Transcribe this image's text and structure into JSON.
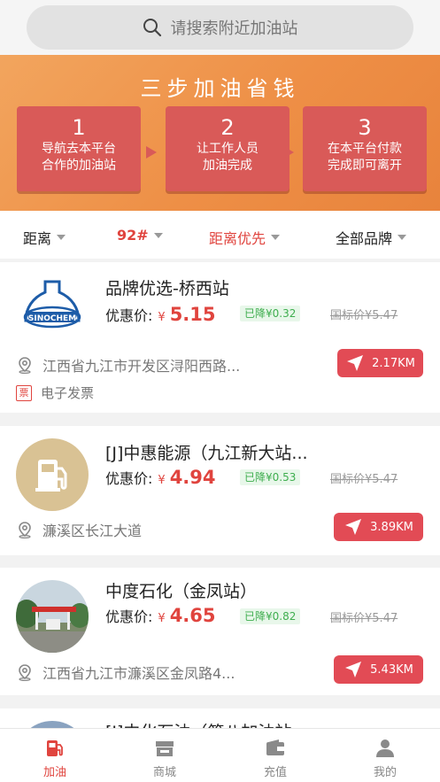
{
  "search": {
    "placeholder": "请搜索附近加油站"
  },
  "banner": {
    "title": "三步加油省钱",
    "steps": [
      {
        "num": "1",
        "line1": "导航去本平台",
        "line2": "合作的加油站"
      },
      {
        "num": "2",
        "line1": "让工作人员",
        "line2": "加油完成"
      },
      {
        "num": "3",
        "line1": "在本平台付款",
        "line2": "完成即可离开"
      }
    ]
  },
  "filters": [
    {
      "label": "距离",
      "active": false
    },
    {
      "label": "92#",
      "active": true
    },
    {
      "label": "距离优先",
      "active": true
    },
    {
      "label": "全部品牌",
      "active": false
    }
  ],
  "stations": [
    {
      "name": "品牌优选-桥西站",
      "price_label": "优惠价:",
      "yen": "¥",
      "price": "5.15",
      "drop": "已降¥0.32",
      "std_price": "国标价¥5.47",
      "address": "江西省九江市开发区浔阳西路...",
      "distance": "2.17KM",
      "invoice": "电子发票",
      "invoice_icon": "票",
      "logo": "sinochem-logo"
    },
    {
      "name": "[J]中惠能源（九江新大站...",
      "price_label": "优惠价:",
      "yen": "¥",
      "price": "4.94",
      "drop": "已降¥0.53",
      "std_price": "国标价¥5.47",
      "address": "濂溪区长江大道",
      "distance": "3.89KM",
      "logo": "fuel-pump-icon"
    },
    {
      "name": "中度石化（金凤站）",
      "price_label": "优惠价:",
      "yen": "¥",
      "price": "4.65",
      "drop": "已降¥0.82",
      "std_price": "国标价¥5.47",
      "address": "江西省九江市濂溪区金凤路4...",
      "distance": "5.43KM",
      "logo": "station-photo"
    },
    {
      "name": "[J]中化石油（第八加油站",
      "logo": "station-photo"
    }
  ],
  "tabbar": [
    {
      "label": "加油",
      "icon": "fuel-icon",
      "active": true
    },
    {
      "label": "商城",
      "icon": "store-icon",
      "active": false
    },
    {
      "label": "充值",
      "icon": "wallet-icon",
      "active": false
    },
    {
      "label": "我的",
      "icon": "user-icon",
      "active": false
    }
  ],
  "colors": {
    "accent": "#e0443e",
    "banner": "#ee8f46",
    "step_box": "#d95a58",
    "distance_button": "#e24b55",
    "discount_green": "#3fae4f"
  }
}
